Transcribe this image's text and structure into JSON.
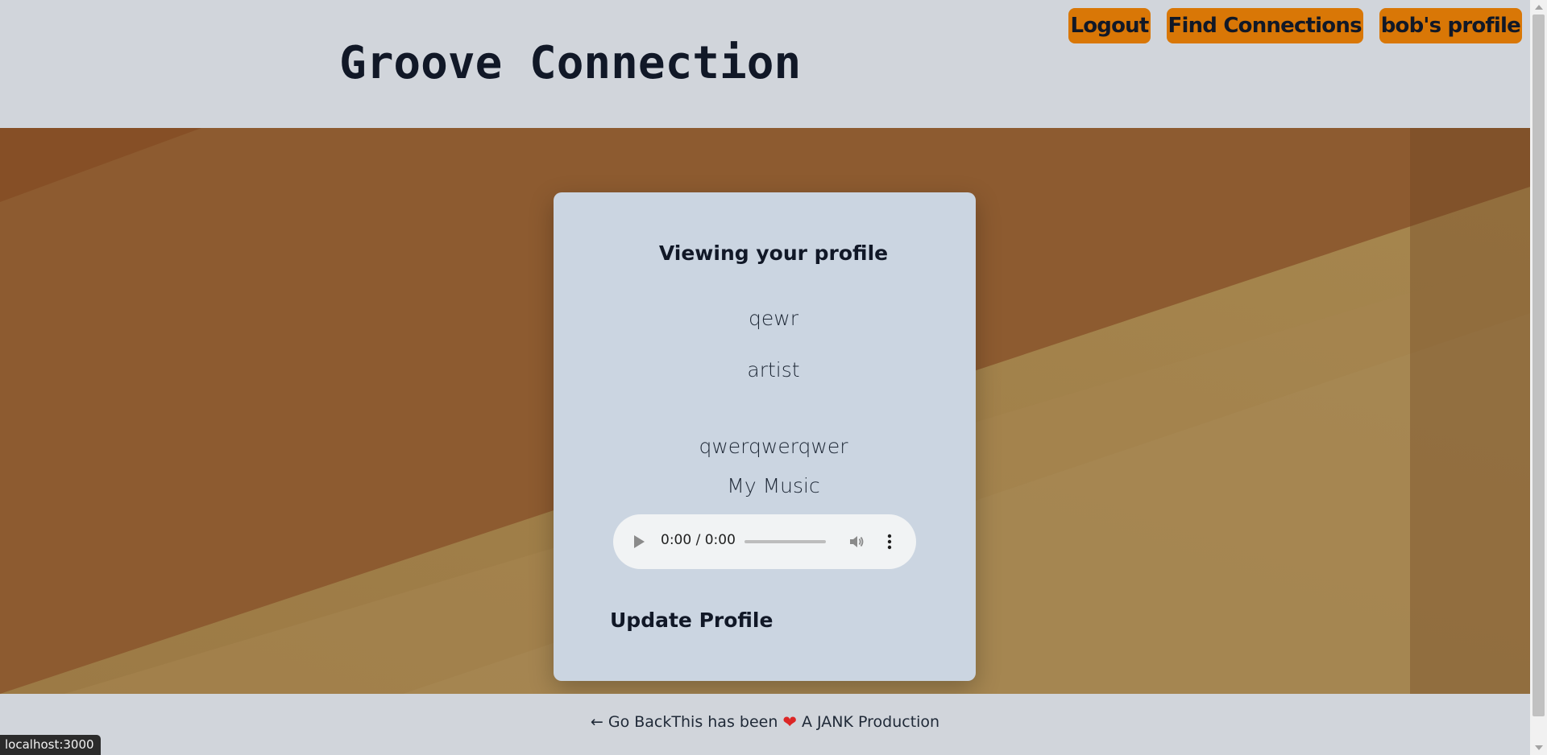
{
  "header": {
    "site_title": "Groove Connection",
    "nav": {
      "logout": "Logout",
      "find_connections": "Find Connections",
      "profile": "bob's profile"
    }
  },
  "profile_card": {
    "heading": "Viewing your profile",
    "name": "qewr",
    "role": "artist",
    "bio": "qwerqwerqwer",
    "music_label": "My Music",
    "audio": {
      "time": "0:00 / 0:00",
      "progress": 0
    },
    "update_link": "Update Profile"
  },
  "footer": {
    "go_back": "← Go Back",
    "text_before": "This has been",
    "heart_icon": "heart-icon",
    "text_after": "A JANK Production"
  },
  "status_bar": {
    "url": "localhost:3000"
  },
  "colors": {
    "button_accent": "#d97706",
    "card_background": "#cbd5e1",
    "page_background": "#d1d5db",
    "hero_brown": "#8d5b30",
    "hero_tan": "#a0824c",
    "heart": "#dc2626"
  }
}
